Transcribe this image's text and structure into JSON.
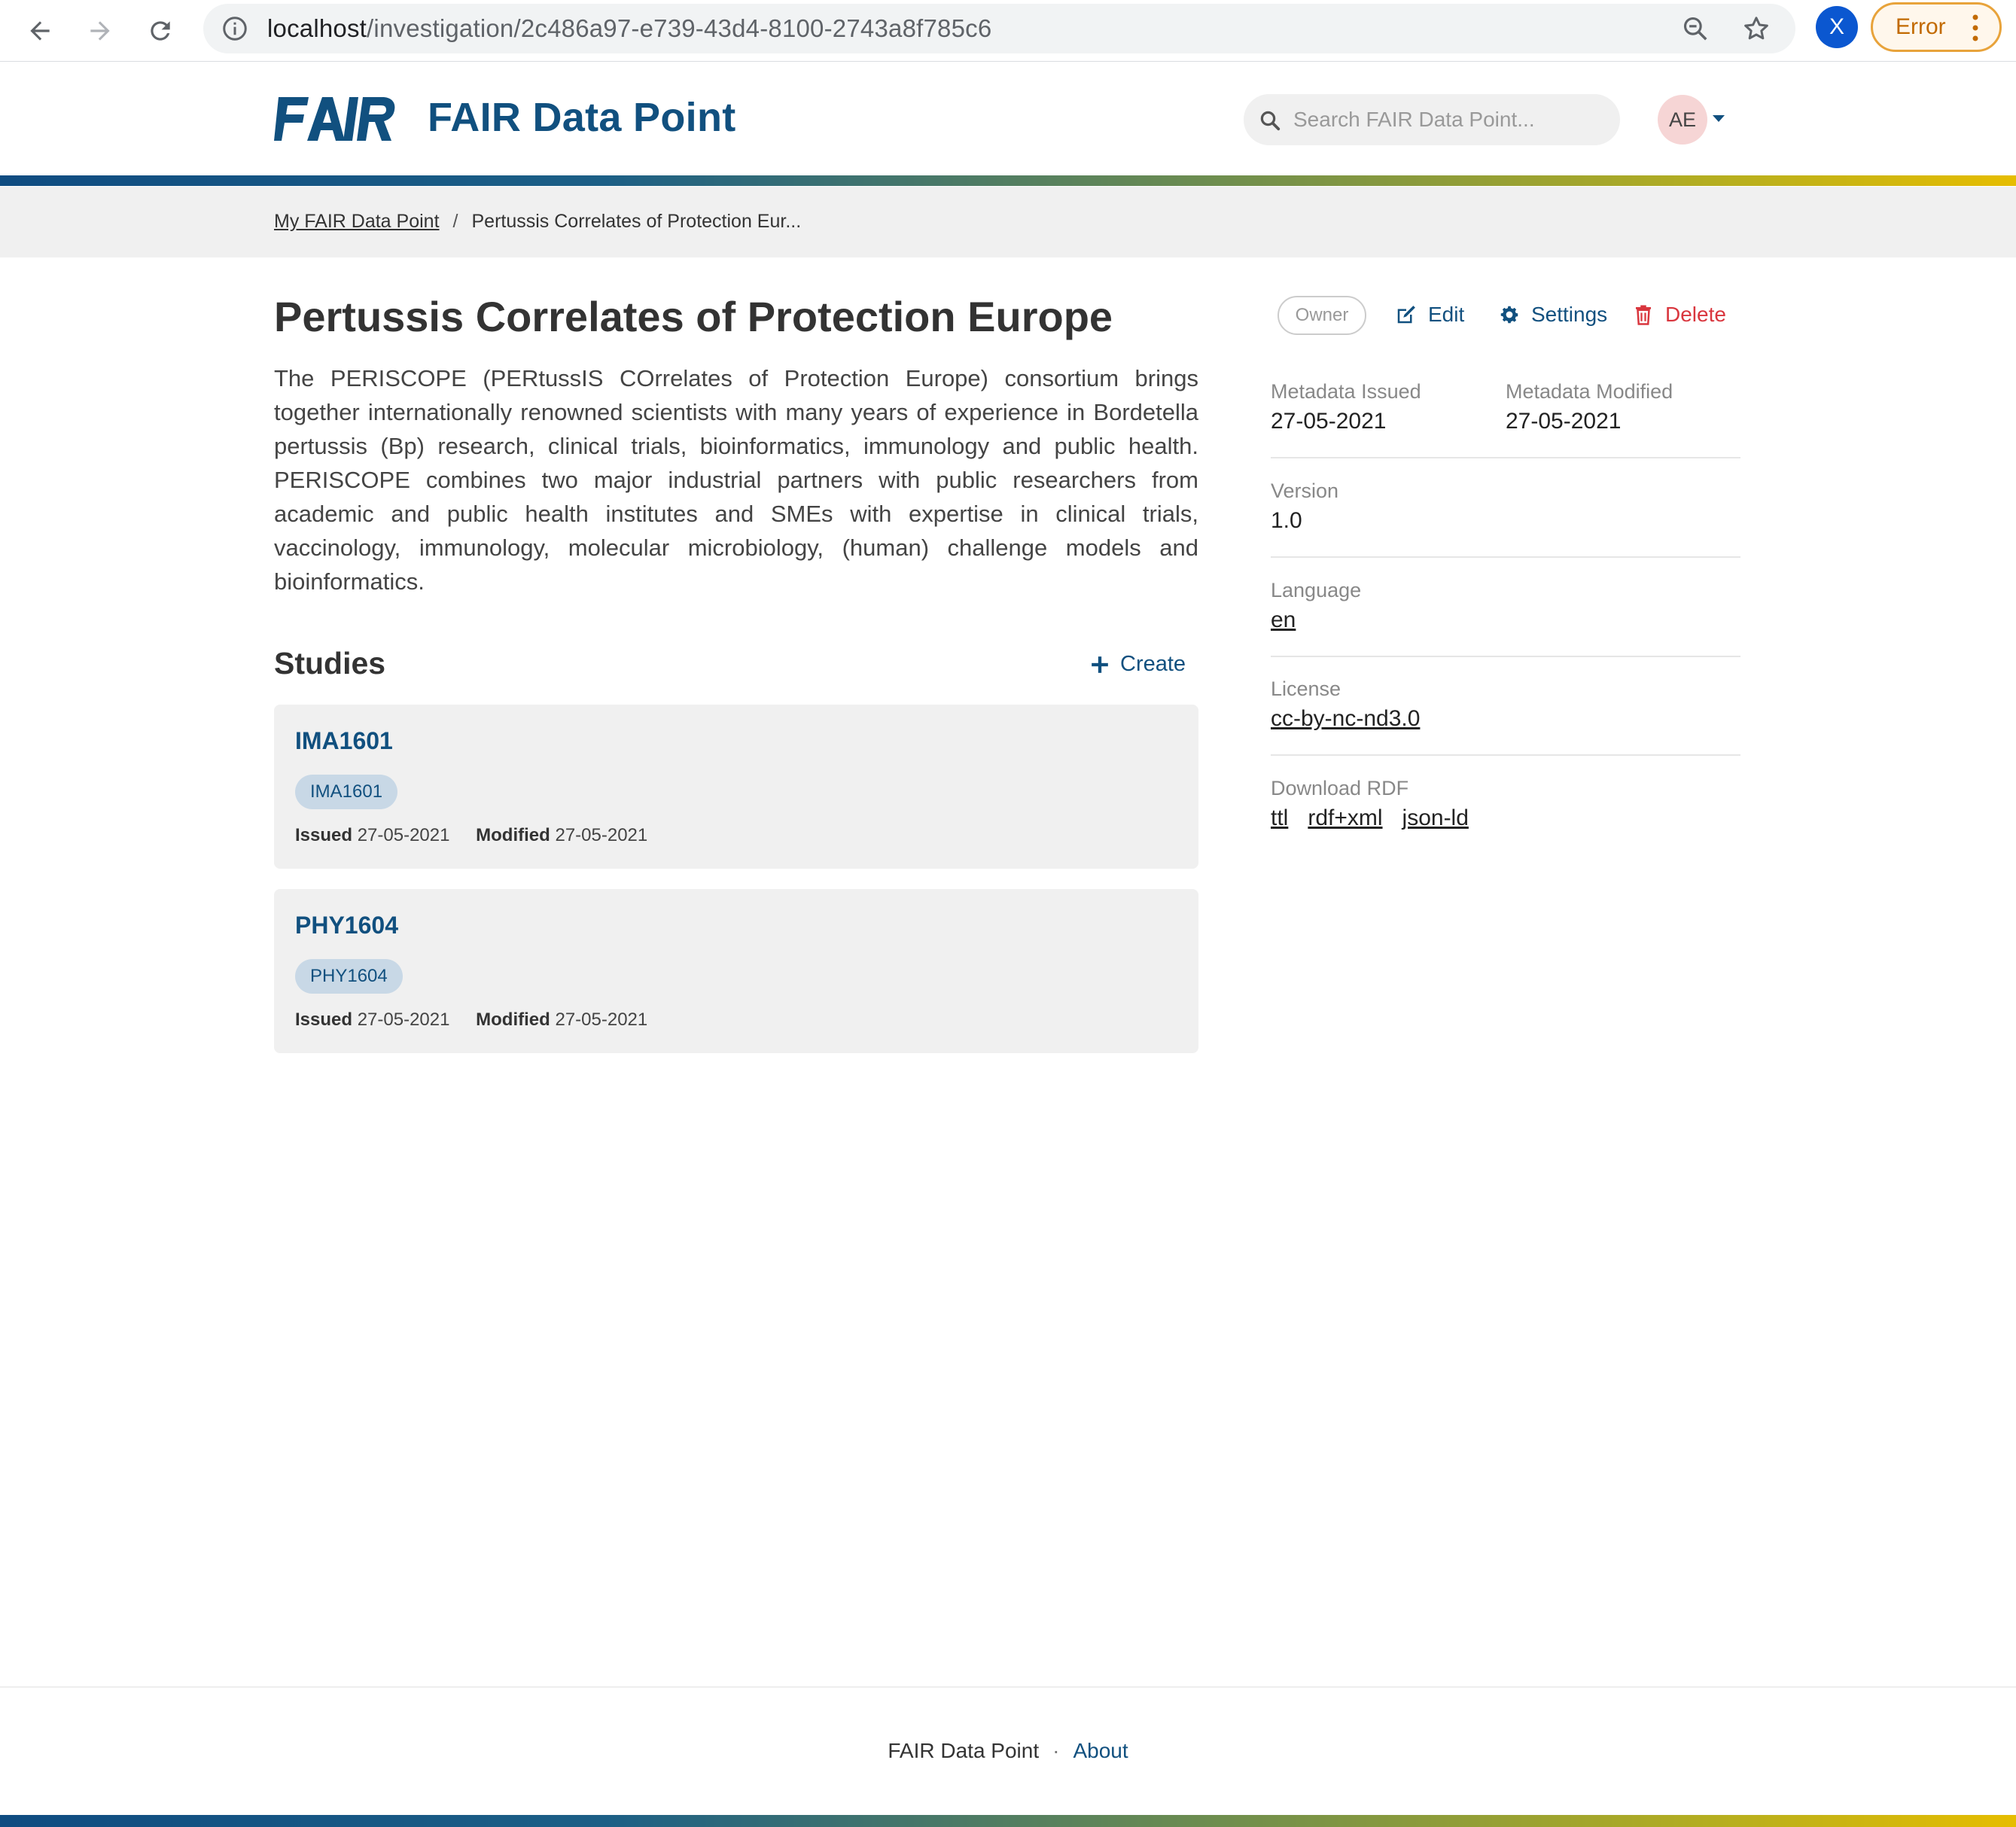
{
  "browser": {
    "url_host": "localhost",
    "url_path": "/investigation/2c486a97-e739-43d4-8100-2743a8f785c6",
    "profile_initial": "X",
    "error_label": "Error"
  },
  "header": {
    "brand_title": "FAIR Data Point",
    "search_placeholder": "Search FAIR Data Point...",
    "user_initials": "AE"
  },
  "breadcrumb": {
    "items": [
      "My FAIR Data Point",
      "Pertussis Correlates of Protection Eur..."
    ],
    "separator": "/"
  },
  "investigation": {
    "title": "Pertussis Correlates of Protection Europe",
    "description": "The PERISCOPE (PERtussIS COrrelates of Protection Europe) consortium brings together internationally renowned scientists with many years of experience in Bordetella pertussis (Bp) research, clinical trials, bioinformatics, immunology and public health. PERISCOPE combines two major industrial partners with public researchers from academic and public health institutes and SMEs with expertise in clinical trials, vaccinology, immunology, molecular microbiology, (human) challenge models and bioinformatics."
  },
  "studies": {
    "title": "Studies",
    "create_label": "Create",
    "issued_label": "Issued",
    "modified_label": "Modified",
    "items": [
      {
        "title": "IMA1601",
        "tag": "IMA1601",
        "issued": "27-05-2021",
        "modified": "27-05-2021"
      },
      {
        "title": "PHY1604",
        "tag": "PHY1604",
        "issued": "27-05-2021",
        "modified": "27-05-2021"
      }
    ]
  },
  "actions": {
    "owner_badge": "Owner",
    "edit": "Edit",
    "settings": "Settings",
    "delete": "Delete"
  },
  "metadata": {
    "issued_label": "Metadata Issued",
    "issued": "27-05-2021",
    "modified_label": "Metadata Modified",
    "modified": "27-05-2021",
    "version_label": "Version",
    "version": "1.0",
    "language_label": "Language",
    "language": "en",
    "license_label": "License",
    "license": "cc-by-nc-nd3.0",
    "download_label": "Download RDF",
    "downloads": [
      "ttl",
      "rdf+xml",
      "json-ld"
    ]
  },
  "footer": {
    "name": "FAIR Data Point",
    "separator": "·",
    "about": "About"
  },
  "colors": {
    "brand_blue": "#11507f",
    "delete_red": "#d9363e",
    "card_bg": "#f0f0f0",
    "tag_bg": "#c8d8e6"
  }
}
